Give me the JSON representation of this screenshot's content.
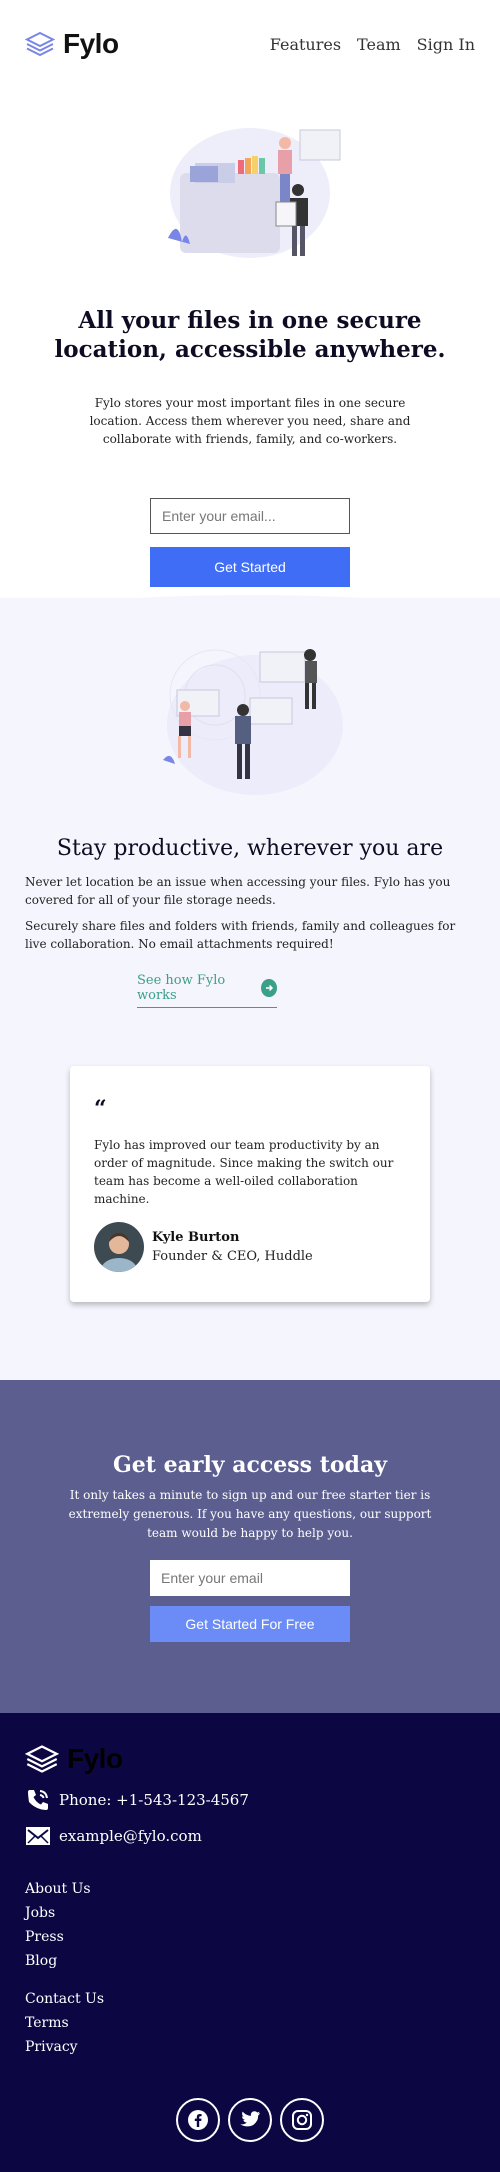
{
  "header": {
    "logo_text": "Fylo",
    "nav": [
      {
        "label": "Features"
      },
      {
        "label": "Team"
      },
      {
        "label": "Sign In"
      }
    ]
  },
  "hero": {
    "title": "All your files in one secure location, accessible anywhere.",
    "description": "Fylo stores your most important files in one secure location. Access them wherever you need, share and collaborate with friends, family, and co-workers.",
    "email_placeholder": "Enter your email...",
    "cta_label": "Get Started"
  },
  "productive": {
    "title": "Stay productive, wherever you are",
    "paragraph1": "Never let location be an issue when accessing your files. Fylo has you covered for all of your file storage needs.",
    "paragraph2": "Securely share files and folders with friends, family and colleagues for live collaboration. No email attachments required!",
    "link_label": "See how Fylo works"
  },
  "testimonial": {
    "quote_mark": "“",
    "text": "Fylo has improved our team productivity by an order of magnitude. Since making the switch our team has become a well-oiled collaboration machine.",
    "author_name": "Kyle Burton",
    "author_role": "Founder & CEO, Huddle"
  },
  "early_access": {
    "title": "Get early access today",
    "description": "It only takes a minute to sign up and our free starter tier is extremely generous. If you have any questions, our support team would be happy to help you.",
    "email_placeholder": "Enter your email",
    "cta_label": "Get Started For Free"
  },
  "footer": {
    "logo_text": "Fylo",
    "phone": "Phone: +1-543-123-4567",
    "email": "example@fylo.com",
    "links_group1": [
      {
        "label": "About Us"
      },
      {
        "label": "Jobs"
      },
      {
        "label": "Press"
      },
      {
        "label": "Blog"
      }
    ],
    "links_group2": [
      {
        "label": "Contact Us"
      },
      {
        "label": "Terms"
      },
      {
        "label": "Privacy"
      }
    ],
    "socials": [
      "facebook-icon",
      "twitter-icon",
      "instagram-icon"
    ]
  },
  "colors": {
    "primary_blue": "#3f6df6",
    "accent_teal": "#3aa08a",
    "early_access_bg": "#5b5e8e",
    "footer_bg": "#0c0742",
    "section_light_bg": "#f5f5fd"
  }
}
